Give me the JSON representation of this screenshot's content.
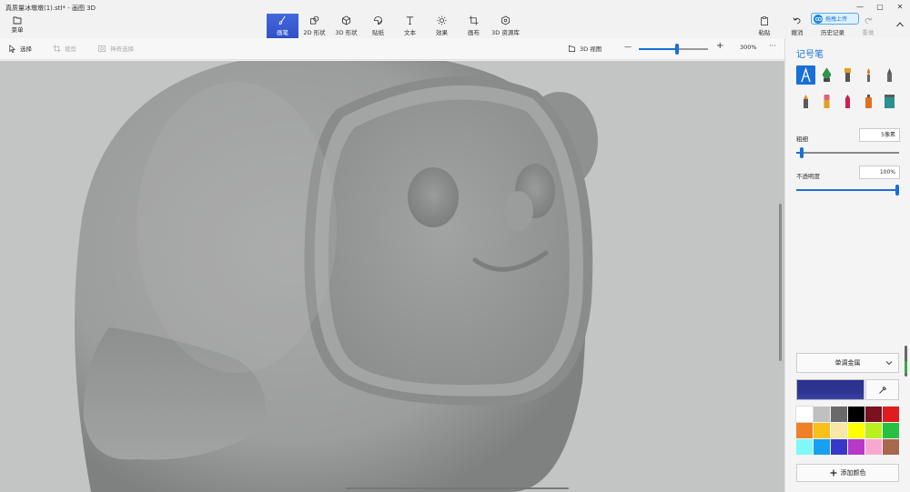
{
  "window": {
    "title": "真质量冰墩墩(1).stl* - 画图 3D",
    "controls": {
      "minimize": "—",
      "maximize": "▢",
      "close": "✕"
    }
  },
  "menu": {
    "label": "菜单",
    "icon": "folder-icon"
  },
  "tools": [
    {
      "id": "brushes",
      "label": "画笔",
      "icon": "brush-icon",
      "active": true
    },
    {
      "id": "shapes2d",
      "label": "2D 形状",
      "icon": "shapes2d-icon",
      "active": false
    },
    {
      "id": "shapes3d",
      "label": "3D 形状",
      "icon": "cube-icon",
      "active": false
    },
    {
      "id": "stickers",
      "label": "贴纸",
      "icon": "sticker-icon",
      "active": false
    },
    {
      "id": "text",
      "label": "文本",
      "icon": "text-icon",
      "active": false
    },
    {
      "id": "effects",
      "label": "效果",
      "icon": "sun-icon",
      "active": false
    },
    {
      "id": "canvas",
      "label": "画布",
      "icon": "crop-icon",
      "active": false
    },
    {
      "id": "library",
      "label": "3D 资源库",
      "icon": "library-icon",
      "active": false
    }
  ],
  "right_actions": {
    "paste": "粘贴",
    "undo": "撤消",
    "history": "历史记录",
    "redo": "重做"
  },
  "upload_pill": {
    "label": "拖拽上传"
  },
  "subbar": {
    "select": "选择",
    "crop": "裁剪",
    "magic_select": "神奇选择",
    "view3d": "3D 视图",
    "zoom_minus": "—",
    "zoom_plus": "+",
    "zoom_value": "300%",
    "zoom_level": 0.55,
    "more": "···"
  },
  "panel": {
    "title": "记号笔",
    "brushes": [
      {
        "name": "marker",
        "color": "#1a6fd8",
        "selected": true
      },
      {
        "name": "calligraphy-pen",
        "color": "#2a9a4a",
        "selected": false
      },
      {
        "name": "oil-brush",
        "color": "#e0a020",
        "selected": false
      },
      {
        "name": "watercolor",
        "color": "#e07a20",
        "selected": false
      },
      {
        "name": "pixel-pen",
        "color": "#556",
        "selected": false
      },
      {
        "name": "pencil",
        "color": "#e08a20",
        "selected": false
      },
      {
        "name": "eraser",
        "color": "#e06080",
        "selected": false
      },
      {
        "name": "crayon",
        "color": "#d02050",
        "selected": false
      },
      {
        "name": "spray-can",
        "color": "#e07020",
        "selected": false
      },
      {
        "name": "fill",
        "color": "#2a9090",
        "selected": false
      }
    ],
    "thickness": {
      "label": "粗细",
      "value": "5像素",
      "level": 0.05
    },
    "opacity": {
      "label": "不透明度",
      "value": "100%",
      "level": 1.0
    },
    "finish": {
      "label": "单调金属"
    },
    "current_color": "#2d3590",
    "palette": [
      "#ffffff",
      "#c0c0c0",
      "#6a6a6a",
      "#000000",
      "#7a1020",
      "#e01c1c",
      "#f08028",
      "#f8c018",
      "#f8e8a8",
      "#ffff00",
      "#b8f020",
      "#28c040",
      "#80f8f8",
      "#18a0f0",
      "#3838c8",
      "#b838c8",
      "#f8a8d0",
      "#a86850"
    ],
    "add_color": "添加颜色"
  }
}
